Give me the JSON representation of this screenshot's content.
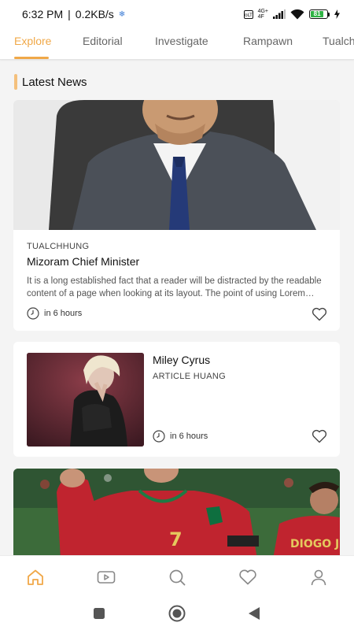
{
  "status_bar": {
    "time": "6:32 PM",
    "separator": "|",
    "speed": "0.2KB/s",
    "network_top": "4G+",
    "network_bottom": "4F",
    "battery": "81"
  },
  "tabs": [
    {
      "label": "Explore",
      "active": true
    },
    {
      "label": "Editorial",
      "active": false
    },
    {
      "label": "Investigate",
      "active": false
    },
    {
      "label": "Rampawn",
      "active": false
    },
    {
      "label": "Tualch",
      "active": false
    }
  ],
  "section": {
    "title": "Latest News"
  },
  "articles": [
    {
      "category": "TUALCHHUNG",
      "title": "Mizoram Chief Minister",
      "excerpt": "It is a long established fact that a reader will be distracted by the readable content of a page when looking at its layout. The point of using Lorem Ipsum",
      "time": "in 6 hours",
      "image": "portrait-of-man-in-suit"
    },
    {
      "category": "ARTICLE HUANG",
      "title": "Miley Cyrus",
      "time": "in 6 hours",
      "image": "performer-on-stage"
    },
    {
      "image": "football-player-celebrating",
      "shirt_text": "DIOGO J",
      "number": "7"
    }
  ],
  "bottom_nav": [
    {
      "icon": "home-icon",
      "active": true
    },
    {
      "icon": "video-icon",
      "active": false
    },
    {
      "icon": "search-icon",
      "active": false
    },
    {
      "icon": "heart-icon",
      "active": false
    },
    {
      "icon": "profile-icon",
      "active": false
    }
  ],
  "colors": {
    "accent": "#f0a848",
    "inactive": "#888888",
    "background": "#f4f4f4"
  }
}
